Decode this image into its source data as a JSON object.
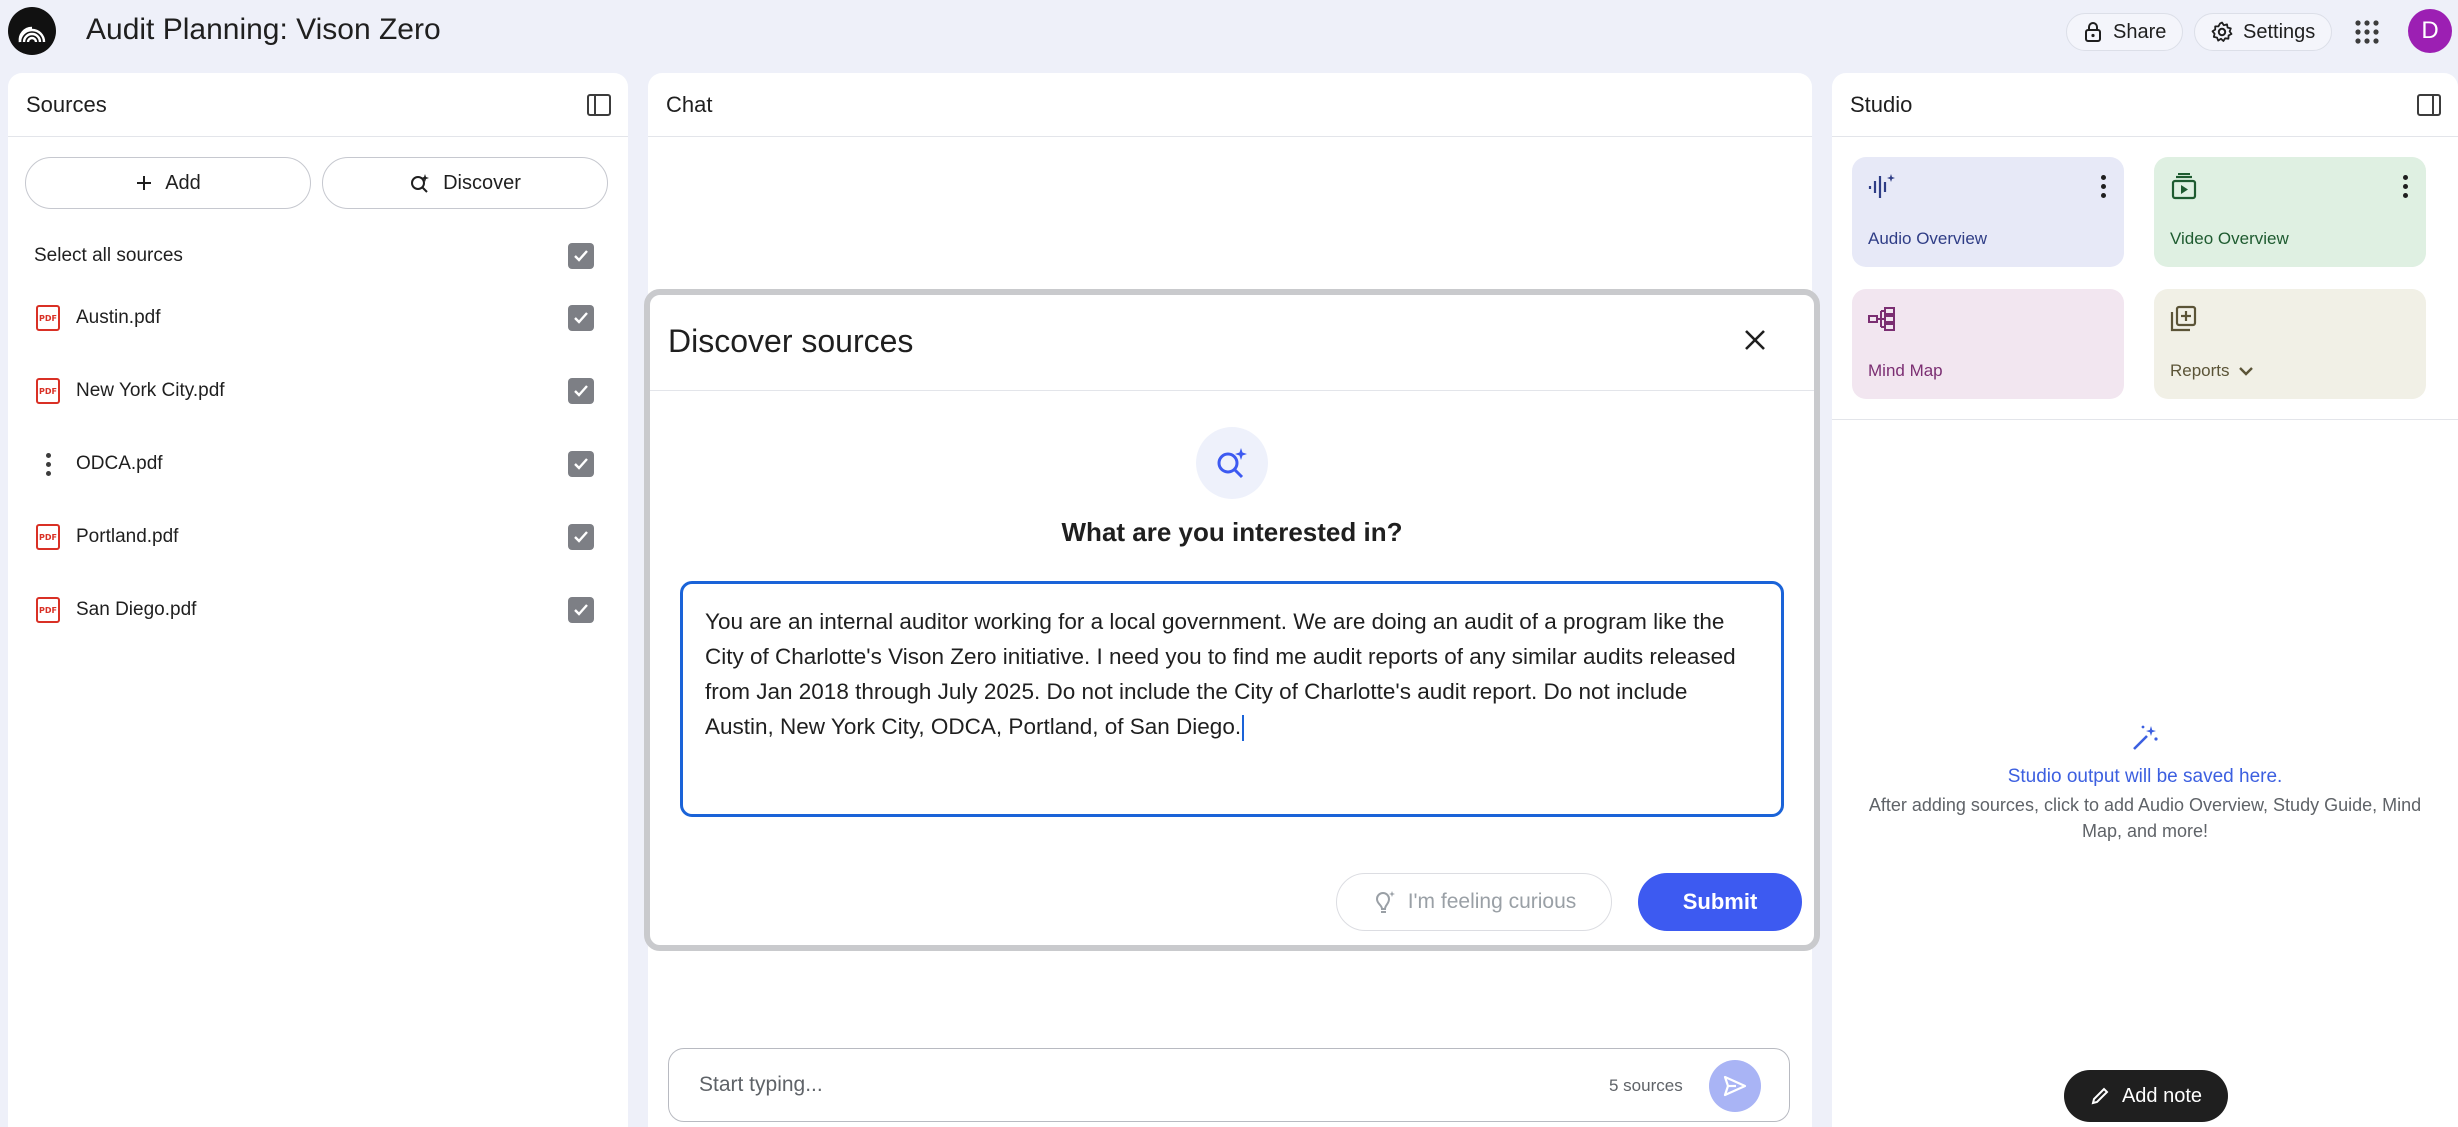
{
  "app": {
    "title": "Audit Planning: Vison Zero",
    "share_label": "Share",
    "settings_label": "Settings",
    "avatar_initial": "D",
    "icons": [
      "notebook-logo-icon",
      "lock-icon",
      "gear-icon",
      "apps-grid-icon"
    ]
  },
  "sources": {
    "title": "Sources",
    "add_label": "Add",
    "discover_label": "Discover",
    "select_all_label": "Select all sources",
    "select_all_checked": true,
    "items": [
      {
        "name": "Austin.pdf",
        "icon": "pdf-icon",
        "checked": true
      },
      {
        "name": "New York City.pdf",
        "icon": "pdf-icon",
        "checked": true
      },
      {
        "name": "ODCA.pdf",
        "icon": "more-vert-icon",
        "checked": true
      },
      {
        "name": "Portland.pdf",
        "icon": "pdf-icon",
        "checked": true
      },
      {
        "name": "San Diego.pdf",
        "icon": "pdf-icon",
        "checked": true
      }
    ]
  },
  "chat": {
    "title": "Chat",
    "placeholder": "Start typing...",
    "source_count": "5 sources"
  },
  "studio": {
    "title": "Studio",
    "tiles": [
      {
        "label": "Audio Overview",
        "icon": "audio-waveform-icon",
        "bg": "#e7e9f7",
        "color": "#2f3d86"
      },
      {
        "label": "Video Overview",
        "icon": "video-play-icon",
        "bg": "#dff0e2",
        "color": "#1e5b30"
      },
      {
        "label": "Mind Map",
        "icon": "mind-map-icon",
        "bg": "#f2e6f0",
        "color": "#7b2e72"
      },
      {
        "label": "Reports",
        "icon": "add-report-icon",
        "bg": "#f1f0e6",
        "color": "#5b5437"
      }
    ],
    "empty_title": "Studio output will be saved here.",
    "empty_desc": "After adding sources, click to add Audio Overview, Study Guide, Mind Map, and more!",
    "add_note_label": "Add note"
  },
  "modal": {
    "title": "Discover sources",
    "question": "What are you interested in?",
    "query": "You are an internal auditor working for a local government. We are doing an audit of a program like the City of Charlotte's Vison Zero initiative. I need you to find me audit reports of any similar audits released from Jan 2018 through July 2025. Do not include the City of Charlotte's audit report. Do not include Austin, New York City, ODCA, Portland, of San Diego.",
    "curious_label": "I'm feeling curious",
    "submit_label": "Submit"
  },
  "colors": {
    "accent": "#3d5af1",
    "focus": "#1a63d8",
    "avatar": "#9c1fb3",
    "pdf": "#d93025"
  }
}
